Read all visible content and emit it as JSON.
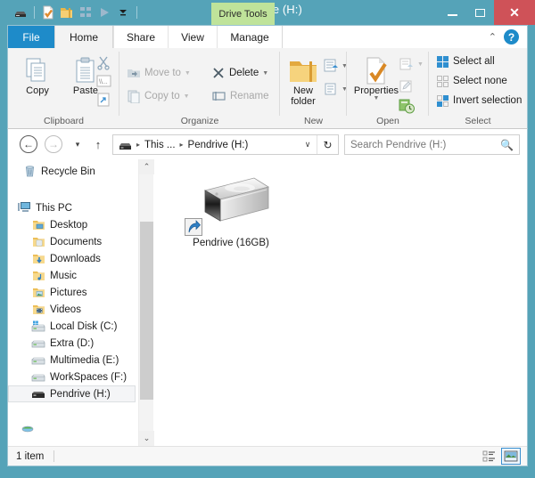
{
  "window": {
    "title": "Pendrive (H:)",
    "contextual_tab": "Drive Tools",
    "quick_access": [
      {
        "name": "drive-icon",
        "label": "Drive"
      },
      {
        "name": "properties-icon",
        "label": "Properties"
      },
      {
        "name": "new-folder-icon",
        "label": "New folder"
      },
      {
        "name": "view-tiles-icon",
        "label": "Tiles"
      },
      {
        "name": "play-icon",
        "label": "Play"
      },
      {
        "name": "customize-icon",
        "label": "Customize Quick Access Toolbar"
      }
    ],
    "controls": {
      "minimize": "–",
      "maximize": "❐",
      "close": "✕"
    }
  },
  "ribbon": {
    "tabs": [
      {
        "label": "File",
        "active": false,
        "file": true
      },
      {
        "label": "Home",
        "active": true
      },
      {
        "label": "Share",
        "active": false
      },
      {
        "label": "View",
        "active": false
      },
      {
        "label": "Manage",
        "active": false
      }
    ],
    "collapse_glyph": "⌃",
    "help_glyph": "?",
    "groups": [
      {
        "name": "Clipboard",
        "label": "Clipboard",
        "big_buttons": [
          {
            "label": "Copy",
            "icon": "copy-icon"
          },
          {
            "label": "Paste",
            "icon": "paste-icon"
          }
        ],
        "small_buttons": [
          {
            "label": "Cut",
            "icon": "cut-icon",
            "disabled": true
          },
          {
            "label": "Copy path",
            "icon": "copy-path-icon",
            "disabled": true
          },
          {
            "label": "Paste shortcut",
            "icon": "paste-shortcut-icon",
            "disabled": true
          }
        ]
      },
      {
        "name": "Organize",
        "label": "Organize",
        "small_buttons": [
          {
            "label": "Move to",
            "icon": "move-to-icon",
            "caret": true,
            "disabled": true
          },
          {
            "label": "Delete",
            "icon": "delete-icon",
            "caret": true,
            "disabled": false
          },
          {
            "label": "Copy to",
            "icon": "copy-to-icon",
            "caret": true,
            "disabled": true
          },
          {
            "label": "Rename",
            "icon": "rename-icon",
            "caret": false,
            "disabled": true
          }
        ]
      },
      {
        "name": "New",
        "label": "New",
        "big_buttons": [
          {
            "label": "New\nfolder",
            "line1": "New",
            "line2": "folder",
            "icon": "new-folder-icon"
          }
        ],
        "small_buttons": [
          {
            "label": "New item",
            "icon": "new-item-icon",
            "caret": true
          },
          {
            "label": "Easy access",
            "icon": "easy-access-icon",
            "caret": true
          }
        ]
      },
      {
        "name": "Open",
        "label": "Open",
        "big_buttons": [
          {
            "label": "Properties",
            "icon": "properties-icon",
            "caret": true
          }
        ],
        "small_buttons": [
          {
            "label": "Open",
            "icon": "open-icon",
            "caret": true,
            "disabled": true
          },
          {
            "label": "Edit",
            "icon": "edit-icon",
            "disabled": true
          },
          {
            "label": "History",
            "icon": "history-icon",
            "disabled": false
          }
        ]
      },
      {
        "name": "Select",
        "label": "Select",
        "small_buttons": [
          {
            "label": "Select all",
            "icon": "select-all-icon"
          },
          {
            "label": "Select none",
            "icon": "select-none-icon"
          },
          {
            "label": "Invert selection",
            "icon": "invert-selection-icon"
          }
        ]
      }
    ]
  },
  "address_bar": {
    "back_glyph": "←",
    "forward_glyph": "→",
    "recent_glyph": "▾",
    "up_glyph": "↑",
    "breadcrumbs": [
      "This ...",
      "Pendrive (H:)"
    ],
    "dropdown_glyph": "∨",
    "refresh_glyph": "↻",
    "search_placeholder": "Search Pendrive (H:)",
    "search_value": "",
    "search_icon": "search-icon"
  },
  "nav_pane": {
    "items": [
      {
        "label": "Recycle Bin",
        "icon": "recycle-bin-icon",
        "indent": 16,
        "selected": false
      },
      {
        "label": "",
        "icon": "spacer",
        "indent": 0,
        "spacer": true
      },
      {
        "label": "This PC",
        "icon": "this-pc-icon",
        "indent": 10,
        "selected": false
      },
      {
        "label": "Desktop",
        "icon": "desktop-folder-icon",
        "indent": 26,
        "selected": false
      },
      {
        "label": "Documents",
        "icon": "documents-folder-icon",
        "indent": 26,
        "selected": false
      },
      {
        "label": "Downloads",
        "icon": "downloads-folder-icon",
        "indent": 26,
        "selected": false
      },
      {
        "label": "Music",
        "icon": "music-folder-icon",
        "indent": 26,
        "selected": false
      },
      {
        "label": "Pictures",
        "icon": "pictures-folder-icon",
        "indent": 26,
        "selected": false
      },
      {
        "label": "Videos",
        "icon": "videos-folder-icon",
        "indent": 26,
        "selected": false
      },
      {
        "label": "Local Disk (C:)",
        "icon": "local-disk-icon",
        "indent": 26,
        "selected": false
      },
      {
        "label": "Extra (D:)",
        "icon": "hard-drive-icon",
        "indent": 26,
        "selected": false
      },
      {
        "label": "Multimedia (E:)",
        "icon": "hard-drive-icon",
        "indent": 26,
        "selected": false
      },
      {
        "label": "WorkSpaces (F:)",
        "icon": "hard-drive-icon",
        "indent": 26,
        "selected": false
      },
      {
        "label": "Pendrive (H:)",
        "icon": "pendrive-icon",
        "indent": 26,
        "selected": true
      },
      {
        "label": "",
        "icon": "spacer",
        "indent": 0,
        "spacer": true
      },
      {
        "label": "",
        "icon": "network-icon",
        "indent": 10,
        "partial": true
      }
    ],
    "scroll_up_glyph": "⌃",
    "scroll_down_glyph": "⌄"
  },
  "content": {
    "items": [
      {
        "label": "Pendrive (16GB)",
        "icon": "usb-pendrive-icon",
        "shortcut": true
      }
    ]
  },
  "status_bar": {
    "item_count": "1 item",
    "views": [
      {
        "name": "details-view-button",
        "active": false
      },
      {
        "name": "large-icons-view-button",
        "active": true
      }
    ]
  },
  "colors": {
    "window_frame": "#55a3b8",
    "file_tab": "#1e8bc9",
    "contextual_tab": "#bfe39a",
    "close_button": "#cf5258",
    "ribbon_bg": "#f3f3f3"
  }
}
